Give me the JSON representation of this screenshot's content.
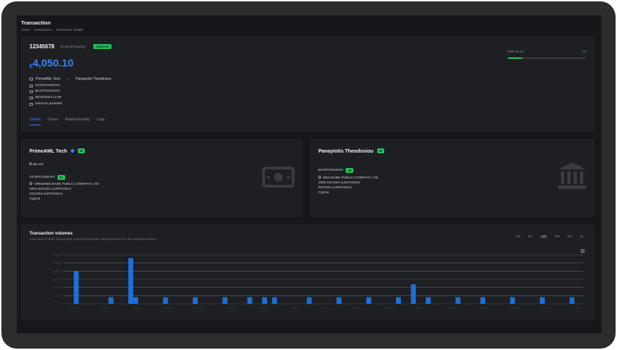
{
  "header": {
    "title": "Transaction",
    "breadcrumb": [
      "Home",
      "Transactions",
      "Transaction Details"
    ]
  },
  "transaction": {
    "id": "12345678",
    "direction": "Incoming/Outgoing",
    "status": "Approved",
    "currency_symbol": "€",
    "amount": "4,050.10",
    "from": "PrimeAML Tech",
    "to": "Panayiotis Theodosiou",
    "from_bic": "OCXPCX2NXXX",
    "to_bic": "BCXPCX2NXXX",
    "datetime": "25/10/2024 12:00",
    "purpose": "Services provided"
  },
  "risk": {
    "label": "Risk Score",
    "value": "19",
    "fill_percent": 19
  },
  "tabs": [
    "Details",
    "Cases",
    "Related Activity",
    "Logs"
  ],
  "sender": {
    "name": "PrimeAML Tech",
    "score": "55",
    "id": "abc-efx",
    "bic": "OCXPCX2NXXX",
    "bic_score": "54",
    "address": [
      "ORDEREE BANK PUBLIC COMPANY LTD",
      "2002 NICOSIA (LEFKOSIA)",
      "NICOSIA (LEFKOSIA)",
      "Cyprus"
    ]
  },
  "receiver": {
    "name": "Panayiotis Theodosiou",
    "score": "40",
    "bic": "BCXPCX2NXXX",
    "bic_score": "38",
    "address": [
      "BEN BANK PUBLIC COMPANY LTD",
      "2002 NICOSIA (LEFKOSIA)",
      "NICOSIA (LEFKOSIA)",
      "Cyprus"
    ]
  },
  "colors": {
    "accent": "#3b82f6",
    "success": "#22c55e",
    "bar": "#1d6fd6"
  },
  "chart": {
    "title": "Transaction volumes",
    "subtitle": "Overview of daily transaction volumes between counterparties for the selected period",
    "periods": [
      "1d",
      "1w",
      "1m",
      "3m",
      "6m",
      "1y"
    ],
    "active_period": "1m"
  },
  "chart_data": {
    "type": "bar",
    "title": "Transaction volumes",
    "ylim": [
      0,
      60000
    ],
    "y_ticks": [
      "0",
      "100000",
      "200000",
      "300000",
      "400000",
      "500000",
      "600000"
    ],
    "x_tick_labels": [
      "Jun '23",
      "Jul '23",
      "Aug '23",
      "Sep '23",
      "Oct '23",
      "Nov '23",
      "Dec '23",
      "2024",
      "Feb '24",
      "Mar '24",
      "Apr '24",
      "May '24",
      "Jun '24",
      "Jul '24",
      "Aug '24",
      "Sep '24",
      "Oct '24"
    ],
    "x": [
      "2023-06-05",
      "2023-07-10",
      "2023-07-30",
      "2023-08-04",
      "2023-09-03",
      "2023-10-03",
      "2023-11-02",
      "2023-11-27",
      "2023-12-12",
      "2023-12-22",
      "2024-01-26",
      "2024-02-25",
      "2024-03-26",
      "2024-04-25",
      "2024-05-10",
      "2024-05-25",
      "2024-06-24",
      "2024-07-19",
      "2024-08-18",
      "2024-09-17",
      "2024-10-17"
    ],
    "values": [
      40000,
      8000,
      56000,
      8000,
      8000,
      8000,
      8000,
      8000,
      8000,
      8000,
      8000,
      8000,
      8000,
      8000,
      24000,
      8000,
      8000,
      8000,
      8000,
      8000,
      8000
    ],
    "grid": true
  }
}
